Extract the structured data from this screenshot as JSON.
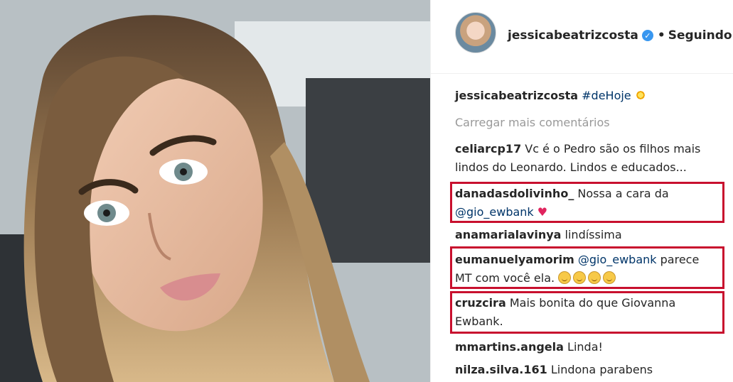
{
  "post": {
    "author": "jessicabeatrizcosta",
    "follow_status": "Seguindo",
    "dot": "•",
    "caption": {
      "user": "jessicabeatrizcosta",
      "text": "#deHoje"
    },
    "load_more": "Carregar mais comentários"
  },
  "comments": [
    {
      "user": "celiarcp17",
      "line1": "Vc é o Pedro são os filhos mais",
      "line2": "lindos do Leonardo. Lindos e educados..."
    },
    {
      "user": "danadasdolivinho_",
      "line1": "Nossa a cara da",
      "mention": "@gio_ewbank",
      "emoji": "heart",
      "highlighted": true
    },
    {
      "user": "anamarialavinya",
      "line1": "lindíssima"
    },
    {
      "user": "eumanuelyamorim",
      "mention": "@gio_ewbank",
      "line1": "parece",
      "line2": "MT com você ela.",
      "emoji": "smiley x4",
      "highlighted": true
    },
    {
      "user": "cruzcira",
      "line1": "Mais bonita do que Giovanna",
      "line2": "Ewbank.",
      "highlighted": true
    },
    {
      "user": "mmartins.angela",
      "line1": "Linda!"
    },
    {
      "user": "nilza.silva.161",
      "line1": "Lindona parabens"
    }
  ],
  "colors": {
    "highlight_box": "#c8102e",
    "mention": "#003569",
    "verified": "#3897f0",
    "muted": "#999999"
  },
  "icons": [
    "verified-badge-icon",
    "sparkle-icon",
    "heart-icon",
    "smiley-icon"
  ]
}
